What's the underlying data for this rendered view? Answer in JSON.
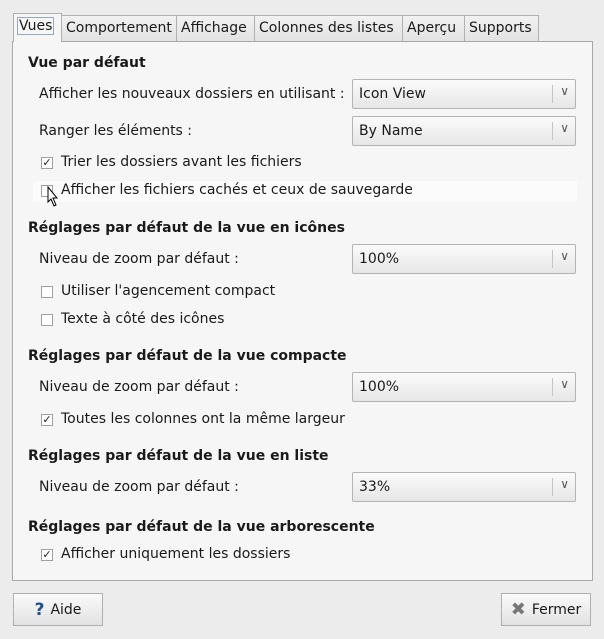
{
  "tabs": [
    "Vues",
    "Comportement",
    "Affichage",
    "Colonnes des listes",
    "Aperçu",
    "Supports"
  ],
  "sections": {
    "default_view": {
      "title": "Vue par défaut",
      "new_folders_label": "Afficher les nouveaux dossiers en utilisant :",
      "new_folders_value": "Icon View",
      "arrange_label": "Ranger les éléments :",
      "arrange_value": "By Name",
      "sort_folders_label": "Trier les dossiers avant les fichiers",
      "sort_folders_checked": true,
      "show_hidden_label": "Afficher les fichiers cachés et ceux de sauvegarde",
      "show_hidden_checked": false
    },
    "icon_view": {
      "title": "Réglages par défaut de la vue en icônes",
      "zoom_label": "Niveau de zoom par défaut :",
      "zoom_value": "100%",
      "compact_label": "Utiliser l'agencement compact",
      "compact_checked": false,
      "text_beside_label": "Texte à côté des icônes",
      "text_beside_checked": false
    },
    "compact_view": {
      "title": "Réglages par défaut de la vue compacte",
      "zoom_label": "Niveau de zoom par défaut :",
      "zoom_value": "100%",
      "same_width_label": "Toutes les colonnes ont la même largeur",
      "same_width_checked": true
    },
    "list_view": {
      "title": "Réglages par défaut de la vue en liste",
      "zoom_label": "Niveau de zoom par défaut :",
      "zoom_value": "33%"
    },
    "tree_view": {
      "title": "Réglages par défaut de la vue arborescente",
      "folders_only_label": "Afficher uniquement les dossiers",
      "folders_only_checked": true
    }
  },
  "buttons": {
    "help": "Aide",
    "close": "Fermer"
  },
  "icons": {
    "help": "question-mark",
    "close": "x-cross"
  }
}
